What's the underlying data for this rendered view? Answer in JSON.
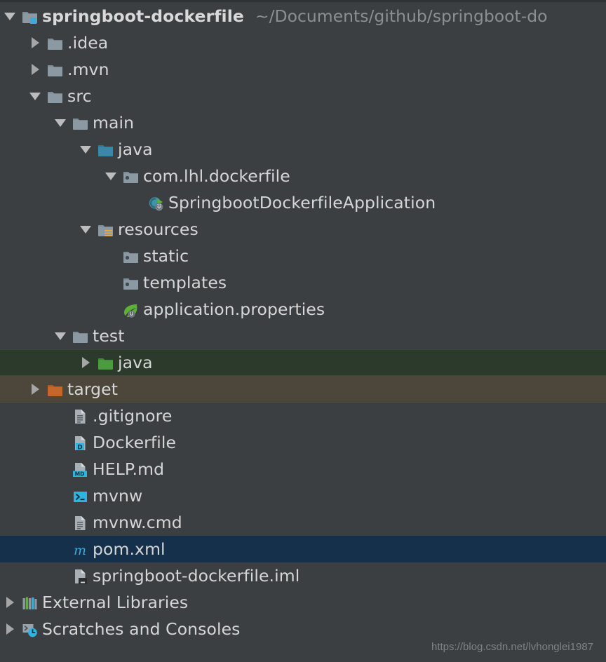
{
  "window": {
    "theme": "darcula",
    "background_color": "#3c3f41",
    "selected_row_color": "#14304a",
    "test_source_row_color": "#2b3a2b",
    "excluded_row_color": "#4c463b",
    "text_color": "#d6d6d6",
    "muted_text_color": "#8c8f91"
  },
  "project_path": "~/Documents/github/springboot-do",
  "watermark": "https://blog.csdn.net/lvhonglei1987",
  "tree": [
    {
      "label": "springboot-dockerfile",
      "icon": "module-folder-icon",
      "arrow": "down",
      "depth": 0,
      "bold": true,
      "path": "~/Documents/github/springboot-do",
      "row_state": "none"
    },
    {
      "label": ".idea",
      "icon": "folder-icon",
      "arrow": "right",
      "depth": 1,
      "bold": false,
      "row_state": "none"
    },
    {
      "label": ".mvn",
      "icon": "folder-icon",
      "arrow": "right",
      "depth": 1,
      "bold": false,
      "row_state": "none"
    },
    {
      "label": "src",
      "icon": "folder-icon",
      "arrow": "down",
      "depth": 1,
      "bold": false,
      "row_state": "none"
    },
    {
      "label": "main",
      "icon": "folder-icon",
      "arrow": "down",
      "depth": 2,
      "bold": false,
      "row_state": "none"
    },
    {
      "label": "java",
      "icon": "source-root-folder-icon",
      "arrow": "down",
      "depth": 3,
      "bold": false,
      "row_state": "none"
    },
    {
      "label": "com.lhl.dockerfile",
      "icon": "package-icon",
      "arrow": "down",
      "depth": 4,
      "bold": false,
      "row_state": "none"
    },
    {
      "label": "SpringbootDockerfileApplication",
      "icon": "spring-boot-class-icon",
      "arrow": "none",
      "depth": 5,
      "bold": false,
      "row_state": "none"
    },
    {
      "label": "resources",
      "icon": "resource-root-folder-icon",
      "arrow": "down",
      "depth": 3,
      "bold": false,
      "row_state": "none"
    },
    {
      "label": "static",
      "icon": "package-icon",
      "arrow": "none",
      "depth": 4,
      "bold": false,
      "row_state": "none"
    },
    {
      "label": "templates",
      "icon": "package-icon",
      "arrow": "none",
      "depth": 4,
      "bold": false,
      "row_state": "none"
    },
    {
      "label": "application.properties",
      "icon": "spring-leaf-icon",
      "arrow": "none",
      "depth": 4,
      "bold": false,
      "row_state": "none"
    },
    {
      "label": "test",
      "icon": "folder-icon",
      "arrow": "down",
      "depth": 2,
      "bold": false,
      "row_state": "none"
    },
    {
      "label": "java",
      "icon": "test-source-root-folder-icon",
      "arrow": "right",
      "depth": 3,
      "bold": false,
      "row_state": "green"
    },
    {
      "label": "target",
      "icon": "excluded-folder-icon",
      "arrow": "right",
      "depth": 1,
      "bold": false,
      "row_state": "brown"
    },
    {
      "label": ".gitignore",
      "icon": "text-file-icon",
      "arrow": "none",
      "depth": 2,
      "bold": false,
      "row_state": "none"
    },
    {
      "label": "Dockerfile",
      "icon": "dockerfile-icon",
      "arrow": "none",
      "depth": 2,
      "bold": false,
      "row_state": "none"
    },
    {
      "label": "HELP.md",
      "icon": "markdown-file-icon",
      "arrow": "none",
      "depth": 2,
      "bold": false,
      "row_state": "none"
    },
    {
      "label": "mvnw",
      "icon": "shell-script-icon",
      "arrow": "none",
      "depth": 2,
      "bold": false,
      "row_state": "none"
    },
    {
      "label": "mvnw.cmd",
      "icon": "text-file-icon",
      "arrow": "none",
      "depth": 2,
      "bold": false,
      "row_state": "none"
    },
    {
      "label": "pom.xml",
      "icon": "maven-pom-icon",
      "arrow": "none",
      "depth": 2,
      "bold": false,
      "row_state": "blue"
    },
    {
      "label": "springboot-dockerfile.iml",
      "icon": "iml-file-icon",
      "arrow": "none",
      "depth": 2,
      "bold": false,
      "row_state": "none"
    },
    {
      "label": "External Libraries",
      "icon": "external-libraries-icon",
      "arrow": "right",
      "depth": 0,
      "bold": false,
      "row_state": "none"
    },
    {
      "label": "Scratches and Consoles",
      "icon": "scratches-icon",
      "arrow": "right",
      "depth": 0,
      "bold": false,
      "row_state": "none"
    }
  ]
}
